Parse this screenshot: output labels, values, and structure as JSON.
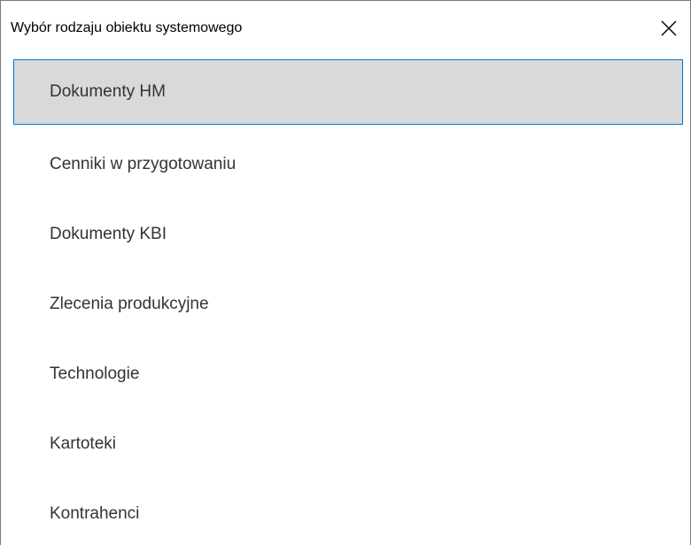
{
  "window": {
    "title": "Wybór rodzaju obiektu systemowego",
    "close_icon": "close-icon"
  },
  "list": {
    "selected_index": 0,
    "items": [
      {
        "label": "Dokumenty HM"
      },
      {
        "label": "Cenniki w przygotowaniu"
      },
      {
        "label": "Dokumenty KBI"
      },
      {
        "label": "Zlecenia produkcyjne"
      },
      {
        "label": "Technologie"
      },
      {
        "label": "Kartoteki"
      },
      {
        "label": "Kontrahenci"
      }
    ]
  },
  "colors": {
    "selection_background": "#d9d9d9",
    "selection_border": "#0078d7"
  }
}
